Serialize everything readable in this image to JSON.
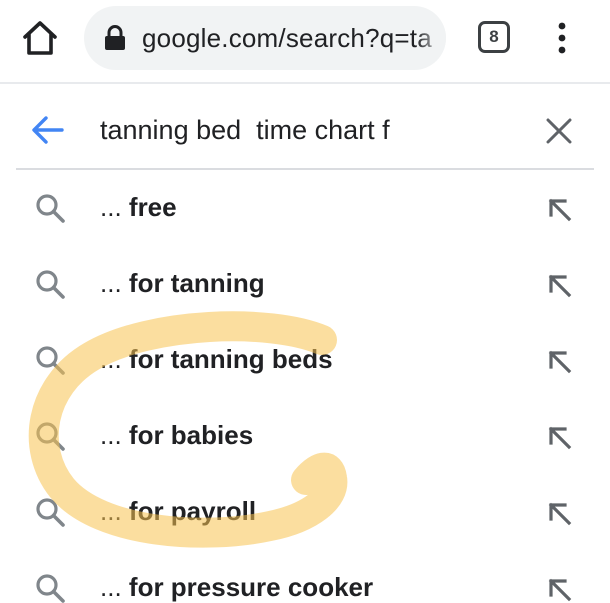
{
  "toolbar": {
    "url": "google.com/search?q=ta",
    "tab_count": "8"
  },
  "search": {
    "query": "tanning bed  time chart f"
  },
  "suggestions": [
    {
      "prefix": "... ",
      "rest": "free"
    },
    {
      "prefix": "... ",
      "rest": "for tanning"
    },
    {
      "prefix": "... ",
      "rest": "for tanning beds"
    },
    {
      "prefix": "... ",
      "rest": "for babies"
    },
    {
      "prefix": "... ",
      "rest": "for payroll"
    },
    {
      "prefix": "... ",
      "rest": "for pressure cooker"
    }
  ],
  "colors": {
    "accent": "#4285f4",
    "icon_gray": "#5f6368",
    "text": "#202124",
    "highlight": "#f7c250"
  },
  "icons": {
    "home": "home-icon",
    "lock": "lock-icon",
    "menu": "more-vert-icon",
    "back": "arrow-back-icon",
    "clear": "close-icon",
    "suggestion": "search-icon",
    "fill": "arrow-up-left-icon"
  }
}
